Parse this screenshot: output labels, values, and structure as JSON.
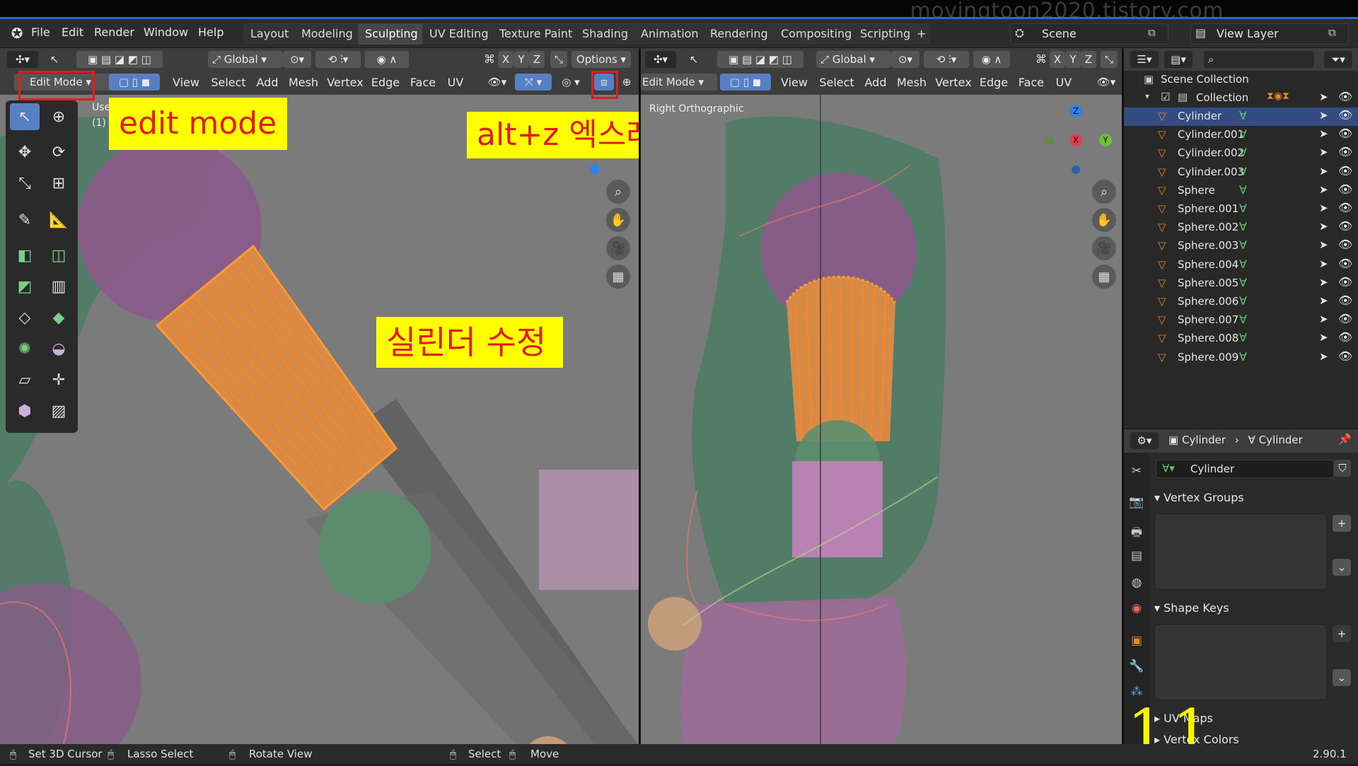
{
  "watermark": "movingtoon2020.tistory.com",
  "menus": [
    "File",
    "Edit",
    "Render",
    "Window",
    "Help"
  ],
  "workspaces": [
    "Layout",
    "Modeling",
    "Sculpting",
    "UV Editing",
    "Texture Paint",
    "Shading",
    "Animation",
    "Rendering",
    "Compositing",
    "Scripting",
    "+"
  ],
  "active_workspace": "Sculpting",
  "scene": {
    "label": "Scene",
    "view_layer": "View Layer"
  },
  "viewport_left": {
    "transform": "Global",
    "axes": [
      "X",
      "Y",
      "Z"
    ],
    "options": "Options",
    "mode": "Edit Mode",
    "menus": [
      "View",
      "Select",
      "Add",
      "Mesh",
      "Vertex",
      "Edge",
      "Face",
      "UV"
    ],
    "overlay_text": "Use",
    "overlay_text2": "(1)"
  },
  "viewport_right": {
    "transform": "Global",
    "axes": [
      "X",
      "Y",
      "Z"
    ],
    "mode": "Edit Mode",
    "menus": [
      "View",
      "Select",
      "Add",
      "Mesh",
      "Vertex",
      "Edge",
      "Face",
      "UV"
    ],
    "view_label": "Right Orthographic",
    "gizmo": {
      "z": "Z",
      "x": "X",
      "y": "Y"
    }
  },
  "annotations": {
    "edit_mode": "edit mode",
    "xray": "alt+z 엑스레이 모드",
    "cylinder_edit": "실린더 수정",
    "page_number": "11"
  },
  "outliner": {
    "scene_collection": "Scene Collection",
    "collection": "Collection",
    "objects": [
      "Cylinder",
      "Cylinder.001",
      "Cylinder.002",
      "Cylinder.003",
      "Sphere",
      "Sphere.001",
      "Sphere.002",
      "Sphere.003",
      "Sphere.004",
      "Sphere.005",
      "Sphere.006",
      "Sphere.007",
      "Sphere.008",
      "Sphere.009"
    ],
    "selected": "Cylinder"
  },
  "properties": {
    "breadcrumb_object": "Cylinder",
    "breadcrumb_data": "Cylinder",
    "data_name": "Cylinder",
    "sections": [
      "Vertex Groups",
      "Shape Keys",
      "UV Maps",
      "Vertex Colors"
    ]
  },
  "status": {
    "items": [
      "Set 3D Cursor",
      "Lasso Select",
      "Rotate View",
      "Select",
      "Move"
    ],
    "version": "2.90.1"
  },
  "colors": {
    "accent": "#5680c2",
    "annotation_bg": "#ffff00",
    "annotation_text": "#e21c1c",
    "selection": "#ff8a1e"
  }
}
